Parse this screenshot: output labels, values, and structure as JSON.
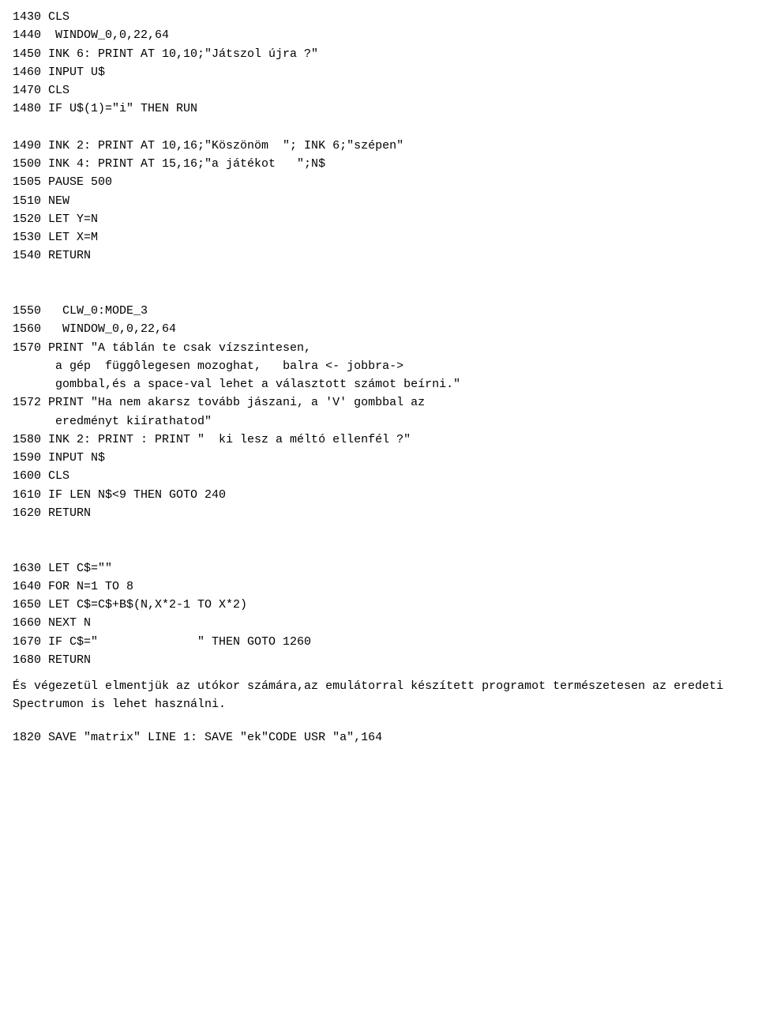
{
  "code_block": {
    "lines": [
      "1430 CLS",
      "1440  WINDOW_0,0,22,64",
      "1450 INK 6: PRINT AT 10,10;\"Játszol újra ?\"",
      "1460 INPUT U$",
      "1470 CLS",
      "1480 IF U$(1)=\"i\" THEN RUN",
      "",
      "1490 INK 2: PRINT AT 10,16;\"Köszönöm  \"; INK 6;\"szépen\"",
      "1500 INK 4: PRINT AT 15,16;\"a játékot   \";N$",
      "1505 PAUSE 500",
      "1510 NEW",
      "1520 LET Y=N",
      "1530 LET X=M",
      "1540 RETURN",
      "",
      "",
      "1550   CLW_0:MODE_3",
      "1560   WINDOW_0,0,22,64",
      "1570 PRINT \"A táblán te csak vízszintesen,",
      "      a gép  függôlegesen mozoghat,   balra <- jobbra->",
      "      gombbal,és a space-val lehet a választott számot beírni.\"",
      "1572 PRINT \"Ha nem akarsz tovább jászani, a 'V' gombbal az",
      "      eredményt kiírathatod\"",
      "1580 INK 2: PRINT : PRINT \"  ki lesz a méltó ellenfél ?\"",
      "1590 INPUT N$",
      "1600 CLS",
      "1610 IF LEN N$<9 THEN GOTO 240",
      "1620 RETURN",
      "",
      "",
      "1630 LET C$=\"\"",
      "1640 FOR N=1 TO 8",
      "1650 LET C$=C$+B$(N,X*2-1 TO X*2)",
      "1660 NEXT N",
      "1670 IF C$=\"              \" THEN GOTO 1260",
      "1680 RETURN"
    ]
  },
  "prose_text": "És végezetül  elmentjük  az  utókor számára,az emulátorral\nkészített  programot természetesen az eredeti Spectrumon is\nlehet használni.",
  "save_line": "1820 SAVE \"matrix\" LINE 1: SAVE \"ek\"CODE USR \"a\",164"
}
